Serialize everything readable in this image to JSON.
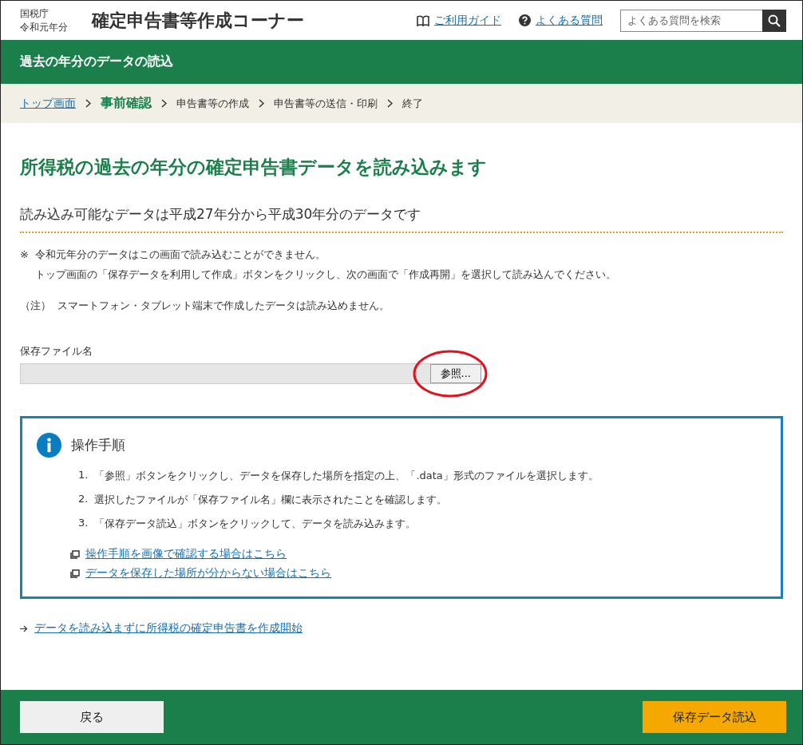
{
  "header": {
    "agency": "国税庁",
    "year": "令和元年分",
    "title": "確定申告書等作成コーナー",
    "links": [
      {
        "kind": "guide",
        "label": "ご利用ガイド"
      },
      {
        "kind": "faq",
        "label": "よくある質問"
      }
    ],
    "search": {
      "placeholder": "よくある質問を検索"
    }
  },
  "page_title": "過去の年分のデータの読込",
  "breadcrumb": [
    {
      "label": "トップ画面",
      "kind": "link"
    },
    {
      "label": "事前確認",
      "kind": "current"
    },
    {
      "label": "申告書等の作成",
      "kind": "step"
    },
    {
      "label": "申告書等の送信・印刷",
      "kind": "step"
    },
    {
      "label": "終了",
      "kind": "step"
    }
  ],
  "heading": "所得税の過去の年分の確定申告書データを読み込みます",
  "subheading": "読み込み可能なデータは平成27年分から平成30年分のデータです",
  "notes": [
    {
      "mark": "※",
      "lines": [
        "令和元年分のデータはこの画面で読み込むことができません。",
        "トップ画面の「保存データを利用して作成」ボタンをクリックし、次の画面で「作成再開」を選択して読み込んでください。"
      ]
    },
    {
      "mark": "（注）",
      "lines": [
        "スマートフォン・タブレット端末で作成したデータは読み込めません。"
      ]
    }
  ],
  "file_field": {
    "label": "保存ファイル名",
    "button": "参照...",
    "highlighted": true
  },
  "instructions": {
    "title": "操作手順",
    "steps": [
      {
        "number": "1.",
        "text": "「参照」ボタンをクリックし、データを保存した場所を指定の上、「.data」形式のファイルを選択します。"
      },
      {
        "number": "2.",
        "text": "選択したファイルが「保存ファイル名」欄に表示されたことを確認します。"
      },
      {
        "number": "3.",
        "text": "「保存データ読込」ボタンをクリックして、データを読み込みます。"
      }
    ],
    "links": [
      "操作手順を画像で確認する場合はこちら",
      "データを保存した場所が分からない場合はこちら"
    ]
  },
  "skip_link": "データを読み込まずに所得税の確定申告書を作成開始",
  "footer": {
    "back": "戻る",
    "submit": "保存データ読込"
  }
}
